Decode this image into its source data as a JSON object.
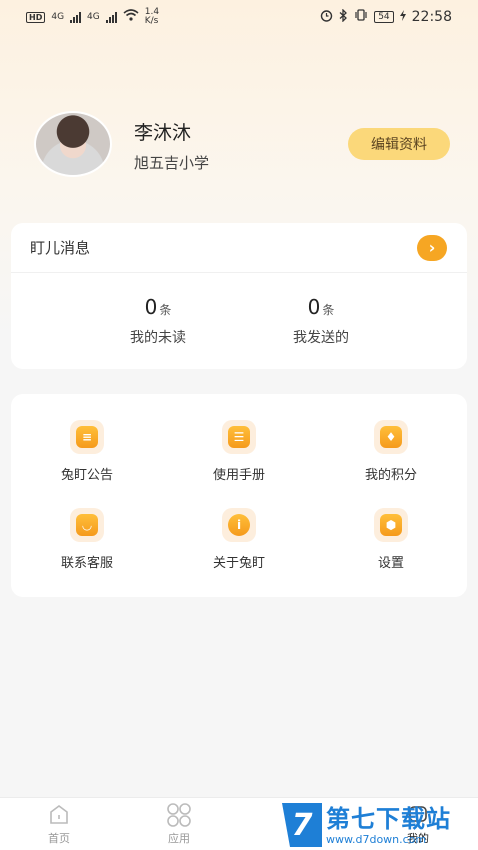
{
  "status_bar": {
    "hd": "HD",
    "net1": "4G",
    "net2": "4G",
    "speed_value": "1.4",
    "speed_unit": "K/s",
    "battery": "54",
    "time": "22:58"
  },
  "profile": {
    "name": "李沐沐",
    "school": "旭五吉小学",
    "edit_label": "编辑资料"
  },
  "messages": {
    "title": "盯儿消息",
    "unread": {
      "count": "0",
      "unit": "条",
      "label": "我的未读"
    },
    "sent": {
      "count": "0",
      "unit": "条",
      "label": "我发送的"
    }
  },
  "menu": {
    "items": [
      {
        "label": "兔盯公告",
        "icon": "announcement-icon"
      },
      {
        "label": "使用手册",
        "icon": "manual-icon"
      },
      {
        "label": "我的积分",
        "icon": "points-icon"
      },
      {
        "label": "联系客服",
        "icon": "customer-service-icon"
      },
      {
        "label": "关于兔盯",
        "icon": "info-icon"
      },
      {
        "label": "设置",
        "icon": "settings-icon"
      }
    ]
  },
  "tab_bar": {
    "tabs": [
      {
        "label": "首页",
        "icon": "home-icon"
      },
      {
        "label": "应用",
        "icon": "apps-icon"
      },
      {
        "label": "我的",
        "icon": "profile-icon"
      }
    ]
  },
  "watermark": {
    "logo": "7",
    "title": "第七下载站",
    "url": "www.d7down.com"
  },
  "colors": {
    "accent": "#f6a623",
    "edit_button": "#fbd87a",
    "watermark": "#1e7fd6"
  }
}
